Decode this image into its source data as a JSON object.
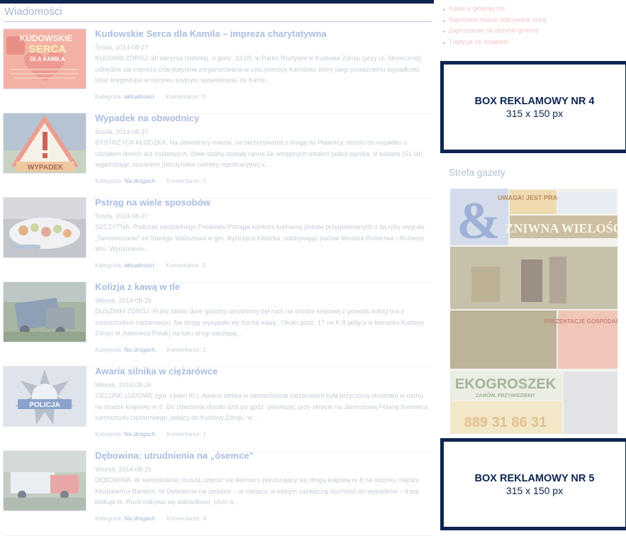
{
  "main": {
    "section_title": "Wiadomości",
    "items": [
      {
        "title": "Kudowskie Serca dla Kamila – impreza charytatywna",
        "date": "Środa, 2014-08-27",
        "text": "KUDOWA ZDRÓJ. 30 sierpnia (sobota), o godz. 12.00, w Parku Roztywni w Kudowie Zdroju (przy ul. Słonecznej) odbędzie się impreza charytatywna zorganizowana w celu pomocy Kamilowi, który uległ poważnemu wypadkowi. Uraz kręgosłupa w odcinku szyjnym spowodował, że Kamil...",
        "category_label": "Kategoria:",
        "category": "aktualności",
        "comments": "Komentarze: 0",
        "thumb_text": [
          "KUDOWSKIE",
          "SERCA",
          "DLA KAMILA"
        ]
      },
      {
        "title": "Wypadek na obwodnicy",
        "date": "Środa, 2014-08-27",
        "text": "BYSTRZYCA KŁODZKA. Na obwodnicy miasta, na skrzyżowaniu z drogą do Pławnicy, doszło do wypadku z udziałem dwóch aut osobowych. Dwie osoby zostały ranne.Ze wstępnych ustaleń policji wynika, iż kobieta (51 lat) wyjeżdżając nissanem (olsztyńskie numery rejestracyjne) z...",
        "category_label": "Kategoria:",
        "category": "Na drogach",
        "comments": "Komentarze: 0",
        "thumb_text": [
          "WYPADEK"
        ]
      },
      {
        "title": "Pstrąg na wiele sposobów",
        "date": "Środa, 2014-08-27",
        "text": "SZCZYTNA. Podczas niedzielnego Festiwalu Pstrąga konkurs kulinarny potraw przygotowanych z tej ryby wygrały „Tamawiczanki” ze Starego Waliszowa w gm. Bystrzyca Kłodzka, zdobywając puchar Ministra Rolnictwa i Rozwoju Wsi. Wyróżniono...",
        "category_label": "Kategoria:",
        "category": "aktualności",
        "comments": "Komentarze: 3",
        "thumb_text": []
      },
      {
        "title": "Kolizja z kawą w tle",
        "date": "Wtorek, 2014-08-26",
        "text": "DUSZNIKI ZDRÓJ. Przez blisko dwie godziny utrudniony był ruch na drodze krajowej z powodu kolizji bra z samochodem ciężarowym. Na drogę wysypało się trochę kawy.. Około godz. 17 na K-8 jadący w kierunku Kudowy Zdroju tir (kierowca Polak) na łuku drogi naczepą...",
        "category_label": "Kategoria:",
        "category": "Na drogach",
        "comments": "Komentarze: 2",
        "thumb_text": []
      },
      {
        "title": "Awaria silnika w ciężarówce",
        "date": "Wtorek, 2014-08-26",
        "text": "ZIELONE LUDOWE (gm. Lewin Kł.). Awaria silnika w samochodzie ciężarowym była przyczyną utrudnień w ruchu na drodze krajowej nr 8. Do zdarzenia doszło dziś po godz. pierwszej, przy skręcie na Jamrozową Polanę.Kierowca samochodu ciężarowego, jadący do Kudowy Zdroju, w...",
        "category_label": "Kategoria:",
        "category": "Na drogach",
        "comments": "Komentarze: 1",
        "thumb_text": [
          "POLICJA"
        ]
      },
      {
        "title": "Dębowina: utrudnienia na „ósemce”",
        "date": "Wtorek, 2014-08-26",
        "text": "DĘBOWINA. W sierpniowość muszą uzbroić się kierowcy poruszający się drogą krajową nr 8 na odcinku między Kłodzkiem a Bardem. W Dębowinie na zjeździe – w miejscu, w którym zazwyczaj dochodzi do wypadków – trasę blokuje tir. Ruch odbywa się wahadłowo, choć w...",
        "category_label": "Kategoria:",
        "category": "Na drogach",
        "comments": "Komentarze: 4",
        "thumb_text": []
      }
    ]
  },
  "sidebar": {
    "links": [
      "Kawa w głównej roli",
      "Tajemnice miasta odkrywane nocą",
      "Zaproszenie na dożynki gminne",
      "Tradycja ze smakiem"
    ],
    "ad_boxes": [
      {
        "title": "BOX REKLAMOWY NR 4",
        "size": "315 x 150 px"
      },
      {
        "title": "BOX REKLAMOWY NR 5",
        "size": "315 x 150 px"
      }
    ],
    "strefa_title": "Strefa gazety",
    "gazeta": {
      "logo": "&",
      "headline": "ŻNIWNA WIELOŚĆ",
      "uwaga": "UWAGA! JEST PRACA!",
      "banner": "EKOGROSZEK",
      "banner_sub": "ZAMÓW, PRZYWIEZIEMY",
      "phone": "889 31 86 31",
      "promo": "PREZENTACJE GOSPODARCZE"
    }
  },
  "colors": {
    "navy": "#0d2550",
    "faded_text": "#c4ccd8",
    "link_red": "#f2c4c4"
  }
}
